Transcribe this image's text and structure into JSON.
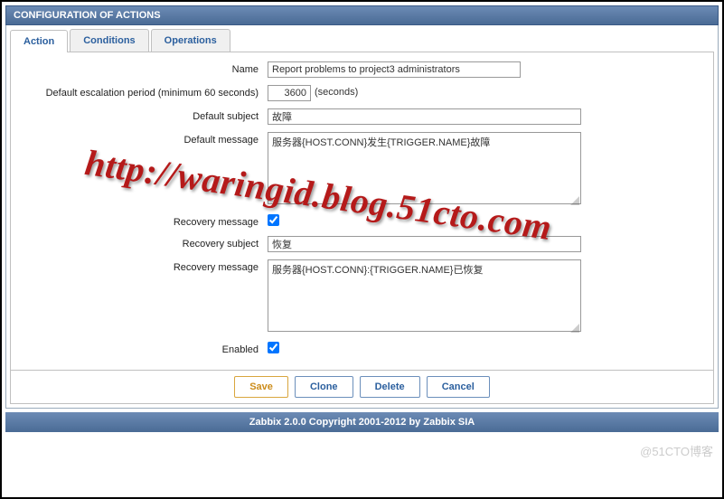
{
  "panel": {
    "title": "CONFIGURATION OF ACTIONS"
  },
  "tabs": {
    "action": "Action",
    "conditions": "Conditions",
    "operations": "Operations"
  },
  "form": {
    "name_label": "Name",
    "name_value": "Report problems to project3 administrators",
    "escalation_label": "Default escalation period (minimum 60 seconds)",
    "escalation_value": "3600",
    "escalation_unit": "(seconds)",
    "default_subject_label": "Default subject",
    "default_subject_value": "故障",
    "default_message_label": "Default message",
    "default_message_value": "服务器{HOST.CONN}发生{TRIGGER.NAME}故障",
    "recovery_message_chk_label": "Recovery message",
    "recovery_message_chk": true,
    "recovery_subject_label": "Recovery subject",
    "recovery_subject_value": "恢复",
    "recovery_message_label": "Recovery message",
    "recovery_message_value": "服务器{HOST.CONN}:{TRIGGER.NAME}已恢复",
    "enabled_label": "Enabled",
    "enabled_chk": true
  },
  "buttons": {
    "save": "Save",
    "clone": "Clone",
    "delete": "Delete",
    "cancel": "Cancel"
  },
  "footer": {
    "text": "Zabbix 2.0.0 Copyright 2001-2012 by Zabbix SIA"
  },
  "watermark": {
    "text": "http://waringid.blog.51cto.com",
    "corner": "@51CTO博客"
  }
}
